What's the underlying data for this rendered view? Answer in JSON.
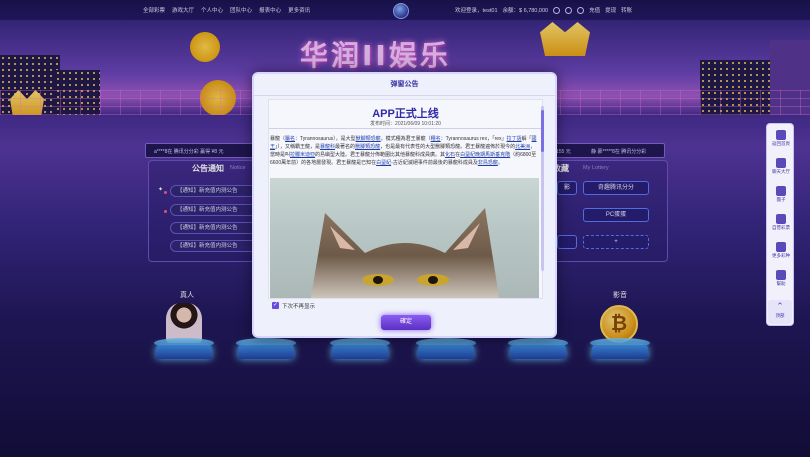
{
  "topnav": {
    "items": [
      "全部彩票",
      "游戏大厅",
      "个人中心",
      "团队中心",
      "报表中心",
      "更多资讯"
    ]
  },
  "user": {
    "welcome": "欢迎登录，",
    "username": "test01",
    "balance_label": "余额：",
    "balance": "$ 6,780,000",
    "actions": [
      "充值",
      "提现",
      "转账"
    ]
  },
  "banner": {
    "title": "华润II娱乐"
  },
  "player_row": {
    "left_text": "a****8在  腾讯分分彩  赢得  ¥8  元",
    "right_pre": "155  元",
    "right_text": "静  慕*****8在  腾讯分分彩"
  },
  "notice_panel": {
    "title": "公告通知",
    "subtitle": "Notice",
    "items": [
      "【通知】新充值内测公告",
      "【通知】新充值内测公告",
      "【通知】新充值内测公告",
      "【通知】新充值内测公告",
      "【通知】新充值内测公告"
    ]
  },
  "favorites": {
    "title": "的收藏",
    "subtitle": "My Lottery",
    "buttons": [
      "影",
      "奇趣腾讯分分",
      "PC蛋蛋",
      "+"
    ]
  },
  "categories": {
    "live": "真人",
    "video": "影音"
  },
  "modal": {
    "header": "弹窗公告",
    "title": "APP正式上线",
    "time": "发布时间：2021/06/09 10:01:20",
    "body_1": "暴龍（",
    "link_1": "屬名",
    "body_2": "：Tyrannosaurus），是大型",
    "link_2": "獸腳類恐龍",
    "body_3": "，模式種為君王暴龍（",
    "link_3": "種名",
    "body_4": "：Tyrannosaurus rex，「rex」",
    "link_4": "拉丁語",
    "body_5": "解「",
    "link_5": "國王",
    "body_6": "」），又稱霸王龍，是",
    "link_6": "暴龍科",
    "body_7": "最著名的",
    "link_7": "獸腳類恐龍",
    "body_8": "，也是最有代表性的大型獸腳類恐龍。君王暴龍遍佈於現今的",
    "link_8": "北美洲",
    "body_9": "，當時是叫",
    "link_9": "拉臘米迪亞",
    "body_10": "的島嶼型大陸。君王暴龍分佈範圍比其他暴龍科成員廣。其",
    "link_10": "化石",
    "body_11": "在",
    "link_11": "白堊紀晚期馬斯垂克階",
    "body_12": "（約6800至6600萬年前）的各地層發現。君王暴龍是已知在",
    "link_12": "白堊紀",
    "body_13": "-古近紀滅絕事件前最後的暴龍科成員及",
    "link_13": "非鳥恐龍",
    "body_14": "。",
    "checkbox_label": "下次不再显示",
    "confirm": "確定"
  },
  "sidebar": {
    "items": [
      "返回首頁",
      "聊天大厅",
      "團子",
      "自营彩票",
      "更多彩种",
      "幫助"
    ],
    "top": "顶部"
  },
  "coin_symbol": "₿"
}
